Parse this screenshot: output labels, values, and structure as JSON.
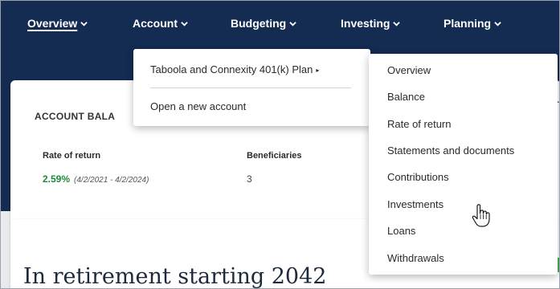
{
  "nav": {
    "items": [
      {
        "label": "Overview",
        "active": true
      },
      {
        "label": "Account",
        "active": false
      },
      {
        "label": "Budgeting",
        "active": false
      },
      {
        "label": "Investing",
        "active": false
      },
      {
        "label": "Planning",
        "active": false
      }
    ]
  },
  "account_menu": {
    "plan_label": "Taboola and Connexity 401(k) Plan",
    "open_account_label": "Open a new account"
  },
  "plan_submenu": {
    "items": [
      "Overview",
      "Balance",
      "Rate of return",
      "Statements and documents",
      "Contributions",
      "Investments",
      "Loans",
      "Withdrawals"
    ]
  },
  "account_card": {
    "title": "ACCOUNT BALA",
    "rate_of_return_label": "Rate of return",
    "rate_of_return_value": "2.59%",
    "rate_of_return_range": "(4/2/2021 - 4/2/2024)",
    "beneficiaries_label": "Beneficiaries",
    "beneficiaries_value": "3"
  },
  "retirement": {
    "heading": "In retirement starting 2042"
  },
  "colors": {
    "nav_bg": "#142b52",
    "positive": "#1f8a3b"
  }
}
